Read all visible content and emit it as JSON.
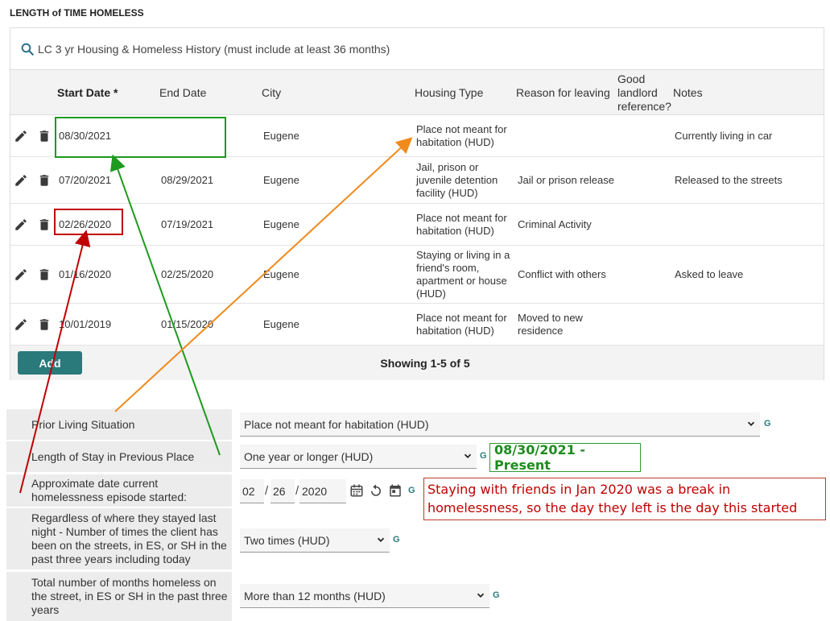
{
  "section_title": "LENGTH of TIME HOMELESS",
  "search": {
    "label": "LC 3 yr Housing & Homeless History (must include at least 36 months)"
  },
  "table": {
    "headers": {
      "start_date": "Start Date",
      "required_mark": "*",
      "end_date": "End Date",
      "city": "City",
      "housing_type": "Housing Type",
      "reason": "Reason for leaving",
      "landlord": "Good landlord reference?",
      "notes": "Notes"
    },
    "rows": [
      {
        "start": "08/30/2021",
        "end": "",
        "city": "Eugene",
        "housing": "Place not meant for habitation (HUD)",
        "reason": "",
        "notes": "Currently living in car"
      },
      {
        "start": "07/20/2021",
        "end": "08/29/2021",
        "city": "Eugene",
        "housing": "Jail, prison or juvenile detention facility (HUD)",
        "reason": "Jail or prison release",
        "notes": "Released to the streets"
      },
      {
        "start": "02/26/2020",
        "end": "07/19/2021",
        "city": "Eugene",
        "housing": "Place not meant for habitation (HUD)",
        "reason": "Criminal Activity",
        "notes": ""
      },
      {
        "start": "01/16/2020",
        "end": "02/25/2020",
        "city": "Eugene",
        "housing": "Staying or living in a friend's room, apartment or house (HUD)",
        "reason": "Conflict with others",
        "notes": "Asked to leave"
      },
      {
        "start": "10/01/2019",
        "end": "01/15/2020",
        "city": "Eugene",
        "housing": "Place not meant for habitation (HUD)",
        "reason": "Moved to new residence",
        "notes": ""
      }
    ],
    "add_label": "Add",
    "showing": "Showing 1-5 of 5"
  },
  "form": {
    "prior_living": {
      "label": "Prior Living Situation",
      "value": "Place not meant for habitation (HUD)",
      "g": "G"
    },
    "length_of_stay": {
      "label": "Length of Stay in Previous Place",
      "value": "One year or longer (HUD)",
      "g": "G"
    },
    "approx_date": {
      "label": "Approximate date current homelessness episode started:",
      "month": "02",
      "day": "26",
      "year": "2020",
      "g": "G"
    },
    "times_homeless": {
      "label": "Regardless of where they stayed last night - Number of times the client has been on the streets, in ES, or SH in the past three years including today",
      "value": "Two times (HUD)",
      "g": "G"
    },
    "months_homeless": {
      "label": "Total number of months homeless on the street, in ES or SH in the past three years",
      "value": "More than 12 months (HUD)",
      "g": "G"
    }
  },
  "annotations": {
    "green_callout": "08/30/2021 - Present",
    "red_callout": "Staying with friends in Jan 2020 was a break in homelessness, so the day they left is the day this started",
    "colors": {
      "green": "#1e8c1e",
      "red": "#c00000",
      "orange": "#f08a1c",
      "teal": "#2a7a7c"
    }
  }
}
